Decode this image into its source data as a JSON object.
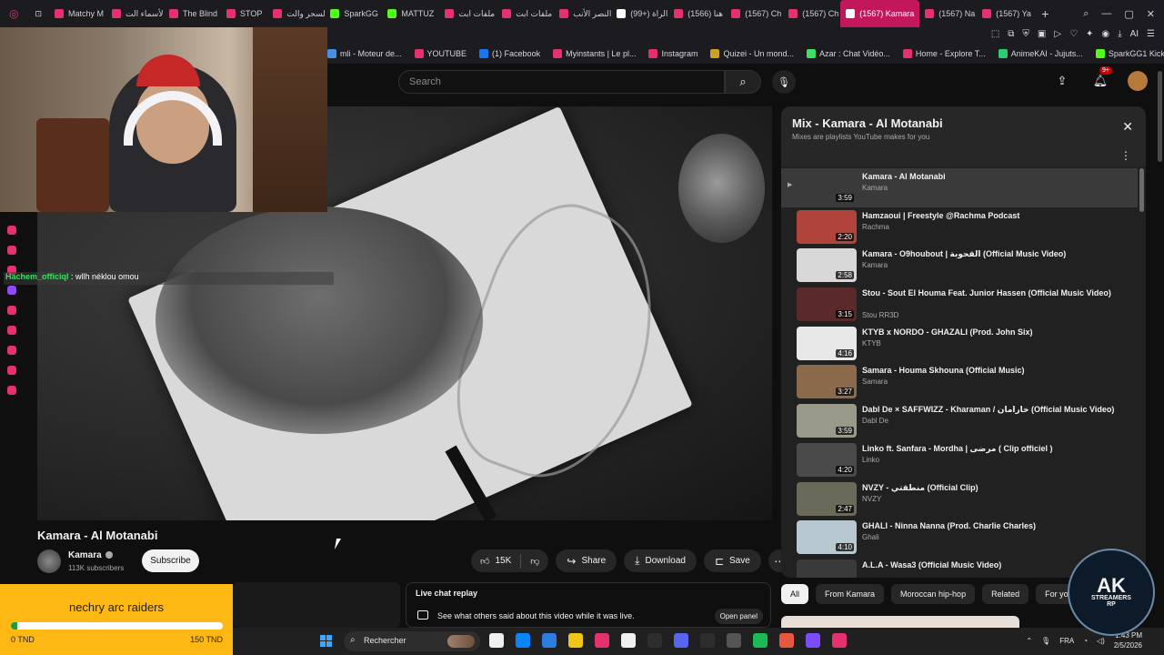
{
  "browser": {
    "tabs": [
      {
        "label": "Matchy M",
        "color": "#e53170"
      },
      {
        "label": "الأسماء الت",
        "color": "#e53170"
      },
      {
        "label": "The Blind",
        "color": "#e53170"
      },
      {
        "label": "STOP",
        "color": "#e53170"
      },
      {
        "label": "السحر والت",
        "color": "#e53170"
      },
      {
        "label": "SparkGG",
        "color": "#53fc18"
      },
      {
        "label": "MATTUZ",
        "color": "#53fc18"
      },
      {
        "label": "ملفات ابت",
        "color": "#e53170"
      },
      {
        "label": "ملفات ابت",
        "color": "#e53170"
      },
      {
        "label": "النصر الأنب",
        "color": "#e53170"
      },
      {
        "label": "(99+) الراة",
        "color": "#ffffff"
      },
      {
        "label": "(1566) هنا",
        "color": "#e53170"
      },
      {
        "label": "(1567) Ch",
        "color": "#e53170"
      },
      {
        "label": "(1567) Ch",
        "color": "#e53170"
      },
      {
        "label": "(1567) Kamara",
        "color": "#ffffff",
        "active": true
      },
      {
        "label": "(1567) Na",
        "color": "#e53170"
      },
      {
        "label": "(1567) Ya",
        "color": "#e53170"
      }
    ],
    "new_tab": "+",
    "bookmarks": [
      {
        "label": "mli - Moteur de...",
        "color": "#4a90e2"
      },
      {
        "label": "YOUTUBE",
        "color": "#e53170"
      },
      {
        "label": "(1) Facebook",
        "color": "#1877f2"
      },
      {
        "label": "Myinstants | Le pl...",
        "color": "#e53170"
      },
      {
        "label": "Instagram",
        "color": "#e1306c"
      },
      {
        "label": "Quizei - Un mond...",
        "color": "#c9a227"
      },
      {
        "label": "Azar : Chat Vidéo...",
        "color": "#3ce063"
      },
      {
        "label": "Home - Explore T...",
        "color": "#e53170"
      },
      {
        "label": "AnimeKAI - Jujuts...",
        "color": "#2ecc71"
      },
      {
        "label": "SparkGG1 Kick",
        "color": "#53fc18"
      }
    ]
  },
  "stream_overlay": {
    "chat_user": "Hachem_officiql",
    "chat_text": ": wllh néklou omou"
  },
  "youtube": {
    "search_placeholder": "Search",
    "notifications_badge": "9+",
    "video": {
      "title": "Kamara - Al Motanabi",
      "channel": "Kamara",
      "subscribers": "113K subscribers",
      "subscribe_label": "Subscribe",
      "likes": "15K",
      "share_label": "Share",
      "download_label": "Download",
      "save_label": "Save"
    },
    "chat_replay": {
      "title": "Live chat replay",
      "description": "See what others said about this video while it was live.",
      "open_panel": "Open panel"
    },
    "mix": {
      "title": "Mix - Kamara - Al Motanabi",
      "subtitle": "Mixes are playlists YouTube makes for you",
      "items": [
        {
          "title": "Kamara - Al Motanabi",
          "channel": "Kamara",
          "duration": "3:59",
          "current": true,
          "thumb": "#3a3a3a"
        },
        {
          "title": "Hamzaoui | Freestyle @Rachma Podcast",
          "channel": "Rachma",
          "duration": "2:20",
          "thumb": "#b0443a"
        },
        {
          "title": "Kamara - O9houbout | القحوبة (Official Music Video)",
          "channel": "Kamara",
          "duration": "2:58",
          "thumb": "#d8d8d8"
        },
        {
          "title": "Stou - Sout El Houma Feat. Junior Hassen (Official Music Video)",
          "channel": "Stou RR3D",
          "duration": "3:15",
          "thumb": "#5a2a2a"
        },
        {
          "title": "KTYB x NORDO - GHAZALI (Prod. John Six)",
          "channel": "KTYB",
          "duration": "4:16",
          "thumb": "#e8e8e8"
        },
        {
          "title": "Samara - Houma Skhouna (Official Music)",
          "channel": "Samara",
          "duration": "3:27",
          "thumb": "#8a6a4a"
        },
        {
          "title": "Dabl De × SAFFWIZZ - Kharaman / خارامان (Official Music Video)",
          "channel": "Dabl De",
          "duration": "3:59",
          "thumb": "#9a9a8a"
        },
        {
          "title": "Linko ft. Sanfara - Mordha | مرضى ( Clip officiel )",
          "channel": "Linko",
          "duration": "4:20",
          "thumb": "#4a4a4a"
        },
        {
          "title": "NVZY - منطقتي (Official Clip)",
          "channel": "NVZY",
          "duration": "2:47",
          "thumb": "#6a6a5a"
        },
        {
          "title": "GHALI - Ninna Nanna (Prod. Charlie Charles)",
          "channel": "Ghali",
          "duration": "4:10",
          "thumb": "#b8c8d0"
        },
        {
          "title": "A.L.A - Wasa3 (Official Music Video)",
          "channel": "",
          "duration": "",
          "thumb": "#3a3a3a"
        }
      ]
    },
    "chips": [
      {
        "label": "All",
        "on": true
      },
      {
        "label": "From Kamara"
      },
      {
        "label": "Moroccan hip-hop"
      },
      {
        "label": "Related"
      },
      {
        "label": "For you"
      }
    ]
  },
  "goal": {
    "name": "nechry arc raiders",
    "min": "0 TND",
    "max": "150 TND",
    "progress": 0.03
  },
  "logo": {
    "line1": "AK",
    "line2": "STREAMERS",
    "line3": "RP"
  },
  "taskbar": {
    "search": "Rechercher",
    "lang": "FRA",
    "time": "1:43 PM",
    "date": "2/5/2026",
    "apps": [
      "#f0f0f0",
      "#0a84ff",
      "#2f7de1",
      "#f0c419",
      "#e53170",
      "#f0f0f0",
      "#2d2d2d",
      "#5865f2",
      "#2d2d2d",
      "#555555",
      "#1db954",
      "#e8573f",
      "#7c4dff",
      "#e53170"
    ]
  }
}
